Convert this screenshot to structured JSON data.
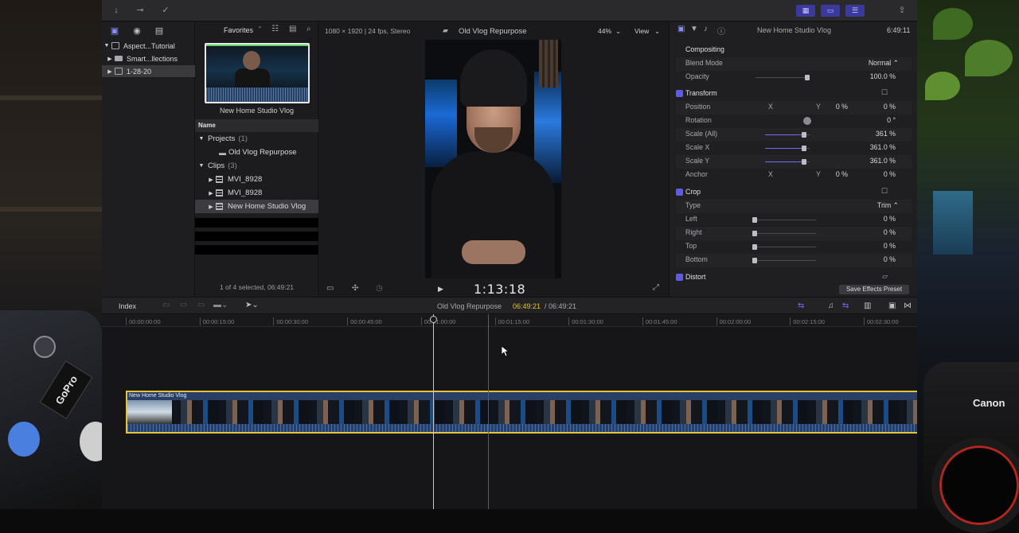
{
  "browser": {
    "filter_label": "Favorites",
    "thumb_caption": "New Home Studio Vlog",
    "column_name": "Name",
    "projects_label": "Projects",
    "projects_count": "(1)",
    "project_item": "Old Vlog Repurpose",
    "clips_label": "Clips",
    "clips_count": "(3)",
    "clip_items": [
      "MVI_8928",
      "MVI_8928",
      "New Home Studio Vlog"
    ],
    "footer": "1 of 4 selected, 06:49:21"
  },
  "library": {
    "items": [
      "Aspect...Tutorial",
      "Smart...llections",
      "1-28-20"
    ]
  },
  "viewer": {
    "format": "1080 × 1920 | 24 fps, Stereo",
    "title": "Old Vlog Repurpose",
    "zoom": "44%",
    "view_label": "View",
    "timecode": "1:13:18"
  },
  "inspector": {
    "clip_name": "New Home Studio Vlog",
    "duration": "6:49:11",
    "compositing": "Compositing",
    "blend_mode_label": "Blend Mode",
    "blend_mode_value": "Normal",
    "opacity_label": "Opacity",
    "opacity_value": "100.0",
    "opacity_unit": "%",
    "transform": "Transform",
    "position_label": "Position",
    "position_x": "0",
    "position_y": "0",
    "rotation_label": "Rotation",
    "rotation_value": "0",
    "rotation_unit": "°",
    "scale_all_label": "Scale (All)",
    "scale_all_value": "361",
    "scale_x_label": "Scale X",
    "scale_x_value": "361.0",
    "scale_y_label": "Scale Y",
    "scale_y_value": "361.0",
    "anchor_label": "Anchor",
    "anchor_x": "0",
    "anchor_y": "0",
    "crop": "Crop",
    "type_label": "Type",
    "type_value": "Trim",
    "left_label": "Left",
    "right_label": "Right",
    "top_label": "Top",
    "bottom_label": "Bottom",
    "crop_value": "0",
    "distort": "Distort",
    "save_preset": "Save Effects Preset",
    "axis_x": "X",
    "axis_y": "Y",
    "unit_pct": "%"
  },
  "timeline": {
    "index_label": "Index",
    "project_name": "Old Vlog Repurpose",
    "current_time": "06:49:21",
    "total_time": "/ 06:49:21",
    "ticks": [
      "00:00:00:00",
      "00:00:15:00",
      "00:00:30:00",
      "00:00:45:00",
      "00:01:00:00",
      "00:01:15:00",
      "00:01:30:00",
      "00:01:45:00",
      "00:02:00:00",
      "00:02:15:00",
      "00:02:30:00"
    ],
    "clip_label": "New Home Studio Vlog"
  },
  "colors": {
    "accent": "#5c5ce6",
    "clip_border": "#e4c33a",
    "skimmer": "#b03a30"
  },
  "background": {
    "gopro_text": "GoPro",
    "canon_text": "Canon"
  }
}
